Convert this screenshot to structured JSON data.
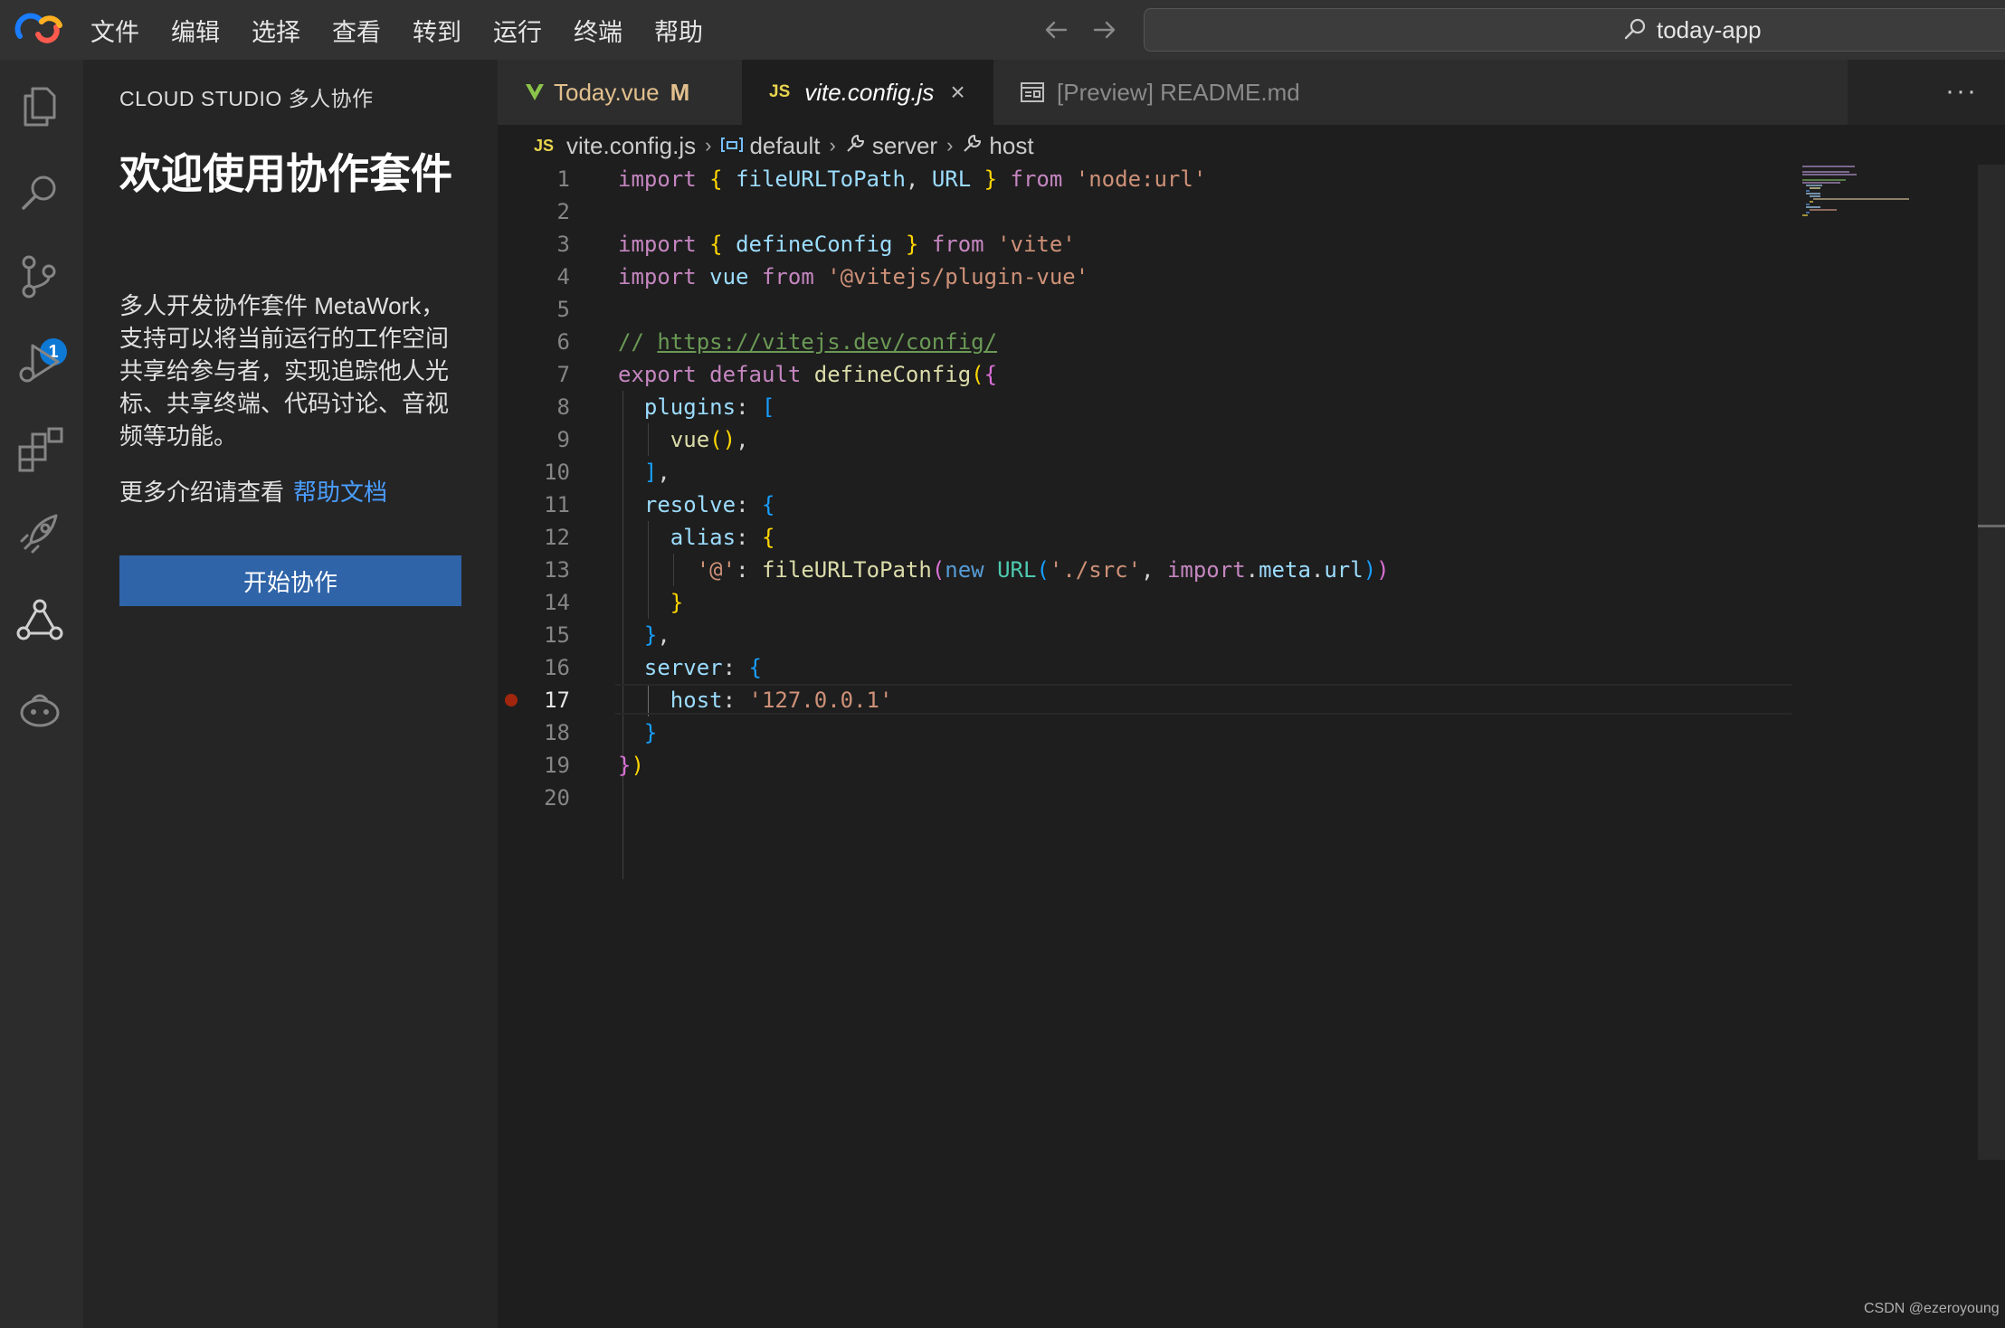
{
  "menu": {
    "items": [
      "文件",
      "编辑",
      "选择",
      "查看",
      "转到",
      "运行",
      "终端",
      "帮助"
    ]
  },
  "command_center": {
    "text": "today-app"
  },
  "activity_bar": {
    "source_control_badge": "1"
  },
  "side_panel": {
    "header": "CLOUD STUDIO 多人协作",
    "title": "欢迎使用协作套件",
    "description": "多人开发协作套件 MetaWork，支持可以将当前运行的工作空间共享给参与者，实现追踪他人光标、共享终端、代码讨论、音视频等功能。",
    "more_text": "更多介绍请查看",
    "link_text": "帮助文档",
    "start_button": "开始协作"
  },
  "tabs": [
    {
      "label": "Today.vue",
      "status": "M"
    },
    {
      "label": "vite.config.js",
      "badge": "JS"
    },
    {
      "label": "[Preview] README.md"
    }
  ],
  "breadcrumb": {
    "badge": "JS",
    "items": [
      "vite.config.js",
      "default",
      "server",
      "host"
    ]
  },
  "editor": {
    "line_numbers": [
      "1",
      "2",
      "3",
      "4",
      "5",
      "6",
      "7",
      "8",
      "9",
      "10",
      "11",
      "12",
      "13",
      "14",
      "15",
      "16",
      "17",
      "18",
      "19",
      "20"
    ],
    "active_line": "17",
    "breakpoint_line": "17"
  },
  "code": {
    "import": "import",
    "from": "from",
    "export": "export",
    "default": "default",
    "new": "new",
    "fileURLToPath": "fileURLToPath",
    "URL": "URL",
    "node_url": "'node:url'",
    "defineConfig": "defineConfig",
    "vite": "'vite'",
    "vue": "vue",
    "plugin_vue": "'@vitejs/plugin-vue'",
    "comment_prefix": "// ",
    "comment_url": "https://vitejs.dev/config/",
    "plugins": "plugins",
    "resolve": "resolve",
    "alias": "alias",
    "at_key": "'@'",
    "src_path": "'./src'",
    "meta": "meta",
    "url": "url",
    "server": "server",
    "host": "host",
    "host_value": "'127.0.0.1'"
  },
  "watermark": "CSDN @ezeroyoung",
  "colors": {
    "keyword": "#c586c0",
    "variable": "#9cdcfe",
    "function": "#dcdcaa",
    "string": "#ce9178",
    "comment": "#6a9955",
    "accent_button": "#2f64a8",
    "link": "#4a9eff",
    "breakpoint": "#a1260d"
  }
}
